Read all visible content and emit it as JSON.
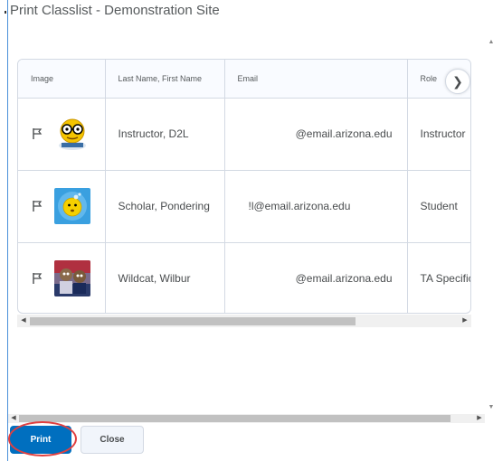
{
  "dialog": {
    "title": "Print Classlist - Demonstration Site"
  },
  "table": {
    "columns": [
      "Image",
      "Last Name, First Name",
      "Email",
      "Role"
    ],
    "rows": [
      {
        "name": "Instructor, D2L",
        "email": "@email.arizona.edu",
        "role": "Instructor",
        "avatar": "glasses-emoji-avatar"
      },
      {
        "name": "Scholar, Pondering",
        "email": "!l@email.arizona.edu",
        "role": "Student",
        "avatar": "thinking-emoji-avatar"
      },
      {
        "name": "Wildcat, Wilbur",
        "email": "@email.arizona.edu",
        "role": "TA Specific",
        "avatar": "wildcat-mascot-avatar"
      }
    ]
  },
  "buttons": {
    "print_label": "Print",
    "close_label": "Close"
  },
  "colors": {
    "primary_button": "#006fbf",
    "highlight_ring": "#e04040",
    "table_border": "#d3d9e3"
  }
}
